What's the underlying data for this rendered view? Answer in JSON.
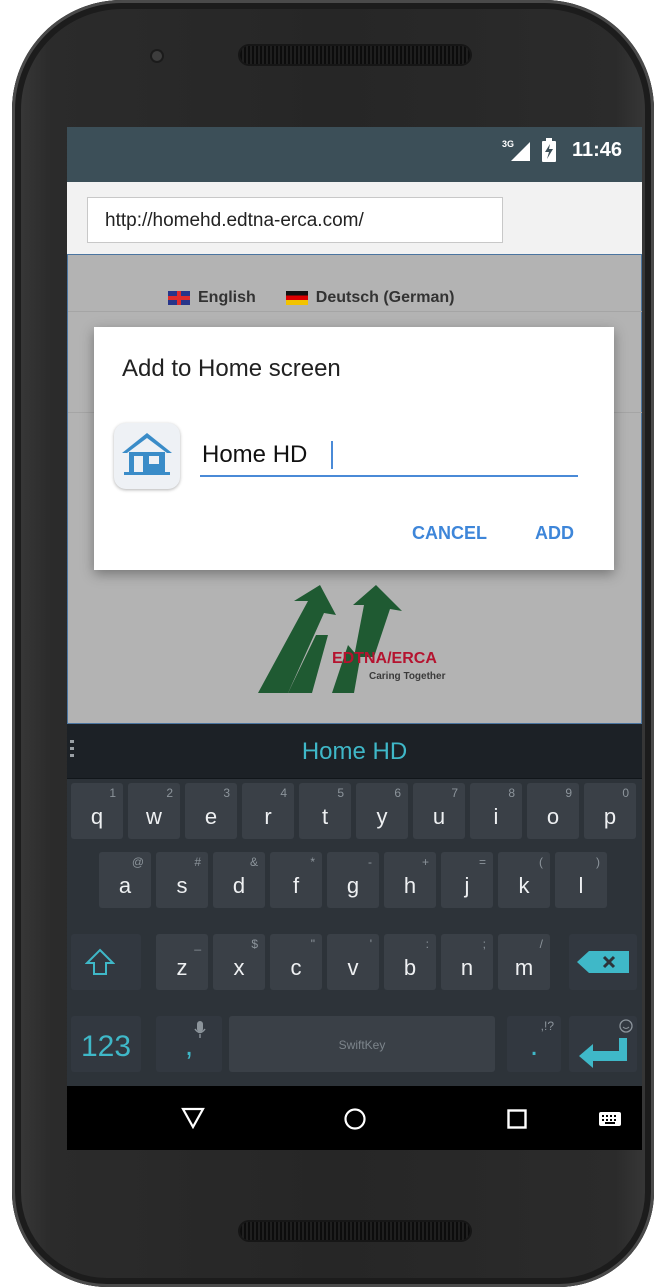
{
  "status_bar": {
    "network": "3G",
    "time": "11:46"
  },
  "browser": {
    "url": "http://homehd.edtna-erca.com/"
  },
  "page": {
    "languages": [
      {
        "label": "English",
        "flag": "uk-flag-icon"
      },
      {
        "label": "Deutsch (German)",
        "flag": "germany-flag-icon"
      }
    ],
    "logo": {
      "title": "EDTNA/ERCA",
      "subtitle": "Caring Together"
    }
  },
  "dialog": {
    "title": "Add to Home screen",
    "name_value": "Home HD",
    "cancel_label": "CANCEL",
    "add_label": "ADD",
    "icon": "house-icon"
  },
  "keyboard": {
    "suggestion": "Home HD",
    "brand": "SwiftKey",
    "row1": [
      {
        "main": "q",
        "sub": "1"
      },
      {
        "main": "w",
        "sub": "2"
      },
      {
        "main": "e",
        "sub": "3"
      },
      {
        "main": "r",
        "sub": "4"
      },
      {
        "main": "t",
        "sub": "5"
      },
      {
        "main": "y",
        "sub": "6"
      },
      {
        "main": "u",
        "sub": "7"
      },
      {
        "main": "i",
        "sub": "8"
      },
      {
        "main": "o",
        "sub": "9"
      },
      {
        "main": "p",
        "sub": "0"
      }
    ],
    "row2": [
      {
        "main": "a",
        "sub": "@"
      },
      {
        "main": "s",
        "sub": "#"
      },
      {
        "main": "d",
        "sub": "&"
      },
      {
        "main": "f",
        "sub": "*"
      },
      {
        "main": "g",
        "sub": "-"
      },
      {
        "main": "h",
        "sub": "+"
      },
      {
        "main": "j",
        "sub": "="
      },
      {
        "main": "k",
        "sub": "("
      },
      {
        "main": "l",
        "sub": ")"
      }
    ],
    "row3": [
      {
        "main": "z",
        "sub": "_"
      },
      {
        "main": "x",
        "sub": "$"
      },
      {
        "main": "c",
        "sub": "\""
      },
      {
        "main": "v",
        "sub": "'"
      },
      {
        "main": "b",
        "sub": ":"
      },
      {
        "main": "n",
        "sub": ";"
      },
      {
        "main": "m",
        "sub": "/"
      }
    ],
    "numbers_label": "123",
    "comma_label": ",",
    "period_label": ".",
    "period_sub": ",!?",
    "accent_color": "#3fb8c8"
  },
  "nav_bar": {
    "back": "back-icon",
    "home": "home-icon",
    "recents": "recents-icon",
    "keyboard": "keyboard-icon"
  }
}
